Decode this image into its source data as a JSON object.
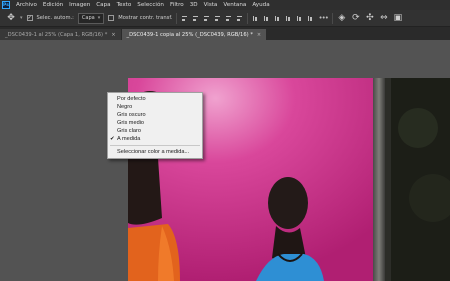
{
  "app": {
    "logo": "Ps"
  },
  "menubar": {
    "items": [
      "Archivo",
      "Edición",
      "Imagen",
      "Capa",
      "Texto",
      "Selección",
      "Filtro",
      "3D",
      "Vista",
      "Ventana",
      "Ayuda"
    ]
  },
  "options_bar": {
    "move_tool_icon": "move-icon",
    "auto_select_label": "Selec. autom.:",
    "auto_select_checked": true,
    "auto_select_target": "Capa",
    "transform_controls_label": "Mostrar contr. transf.",
    "transform_controls_checked": false
  },
  "tabs": [
    {
      "label": "_DSC0439-1 al 25% (Capa 1, RGB/16) *",
      "close": "×",
      "active": false
    },
    {
      "label": "_DSC0439-1 copia al 25% (_DSC0439, RGB/16) *",
      "close": "×",
      "active": true
    }
  ],
  "context_menu": {
    "items": [
      {
        "label": "Por defecto",
        "checked": false
      },
      {
        "label": "Negro",
        "checked": false
      },
      {
        "label": "Gris oscuro",
        "checked": false
      },
      {
        "label": "Gris medio",
        "checked": false
      },
      {
        "label": "Gris claro",
        "checked": false
      },
      {
        "label": "A medida",
        "checked": true
      },
      {
        "label": "Seleccionar color a medida...",
        "checked": false,
        "separator_before": true
      }
    ],
    "check_glyph": "✔"
  },
  "colors": {
    "workspace_bg": "#535353",
    "menubar_bg": "#2f2f2f",
    "photo_backdrop": "#c8328a",
    "accent": "#31a8ff"
  }
}
